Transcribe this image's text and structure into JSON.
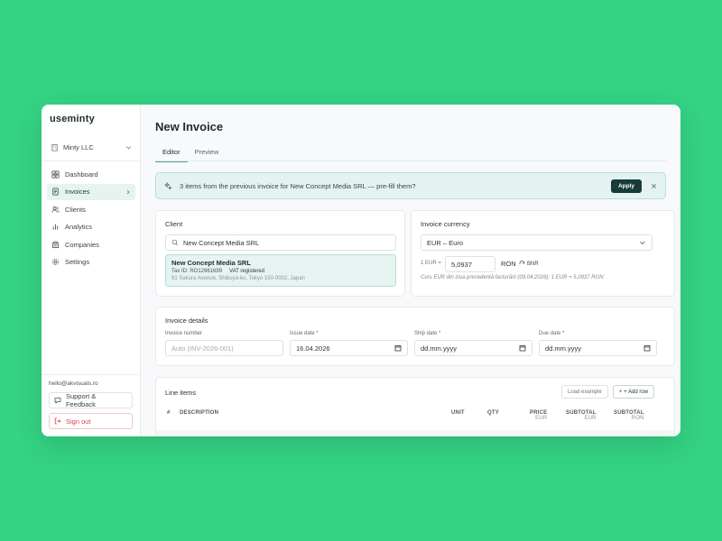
{
  "app": {
    "logo": "useminty"
  },
  "sidebar": {
    "org": "Minty LLC",
    "items": [
      {
        "label": "Dashboard",
        "icon": "grid-icon"
      },
      {
        "label": "Invoices",
        "icon": "invoice-icon",
        "active": true
      },
      {
        "label": "Clients",
        "icon": "users-icon"
      },
      {
        "label": "Analytics",
        "icon": "bar-chart-icon"
      },
      {
        "label": "Companies",
        "icon": "building-icon"
      },
      {
        "label": "Settings",
        "icon": "gear-icon"
      }
    ],
    "email": "hello@akvisuals.ro",
    "support_label": "Support & Feedback",
    "signout_label": "Sign out"
  },
  "main": {
    "title": "New Invoice",
    "tabs": [
      {
        "label": "Editor",
        "active": true
      },
      {
        "label": "Preview"
      }
    ],
    "banner": {
      "text": "3 items from the previous invoice for New Concept Media SRL — pre-fill them?",
      "apply_label": "Apply"
    },
    "client": {
      "title": "Client",
      "search_value": "New Concept Media SRL",
      "selected": {
        "name": "New Concept Media SRL",
        "tax_id": "Tax ID: RO12961699",
        "vat": "VAT registered",
        "address": "91 Sakura Avenue, Shibuya-ku, Tokyo 150-0002, Japan"
      }
    },
    "currency": {
      "title": "Invoice currency",
      "selected": "EUR – Euro",
      "rate_label": "1 EUR =",
      "rate_value": "5,0937",
      "rate_unit": "RON",
      "bnr_label": "BNR",
      "note": "Curs EUR din ziua precedentă facturării (09.04.2026): 1 EUR = 5,0937 RON"
    },
    "details": {
      "title": "Invoice details",
      "invoice_number_label": "Invoice number",
      "invoice_number_placeholder": "Auto (INV-2026-001)",
      "issue_date_label": "Issue date *",
      "issue_date_value": "16.04.2026",
      "ship_date_label": "Ship date *",
      "ship_date_placeholder": "dd.mm.yyyy",
      "due_date_label": "Due date *",
      "due_date_placeholder": "dd.mm.yyyy"
    },
    "line_items": {
      "title": "Line items",
      "load_example_label": "Load example",
      "add_row_label": "+ + Add row",
      "columns": {
        "num": "#",
        "description": "DESCRIPTION",
        "unit": "UNIT",
        "qty": "QTY",
        "price": "PRICE",
        "price_cur": "EUR",
        "subtotal": "SUBTOTAL",
        "subtotal_cur": "EUR",
        "subtotal_ron": "SUBTOTAL",
        "subtotal_ron_cur": "RON"
      }
    }
  },
  "colors": {
    "background": "#34d283",
    "accent": "#173b38",
    "active_bg": "#e7f3f1",
    "danger": "#d84141"
  }
}
